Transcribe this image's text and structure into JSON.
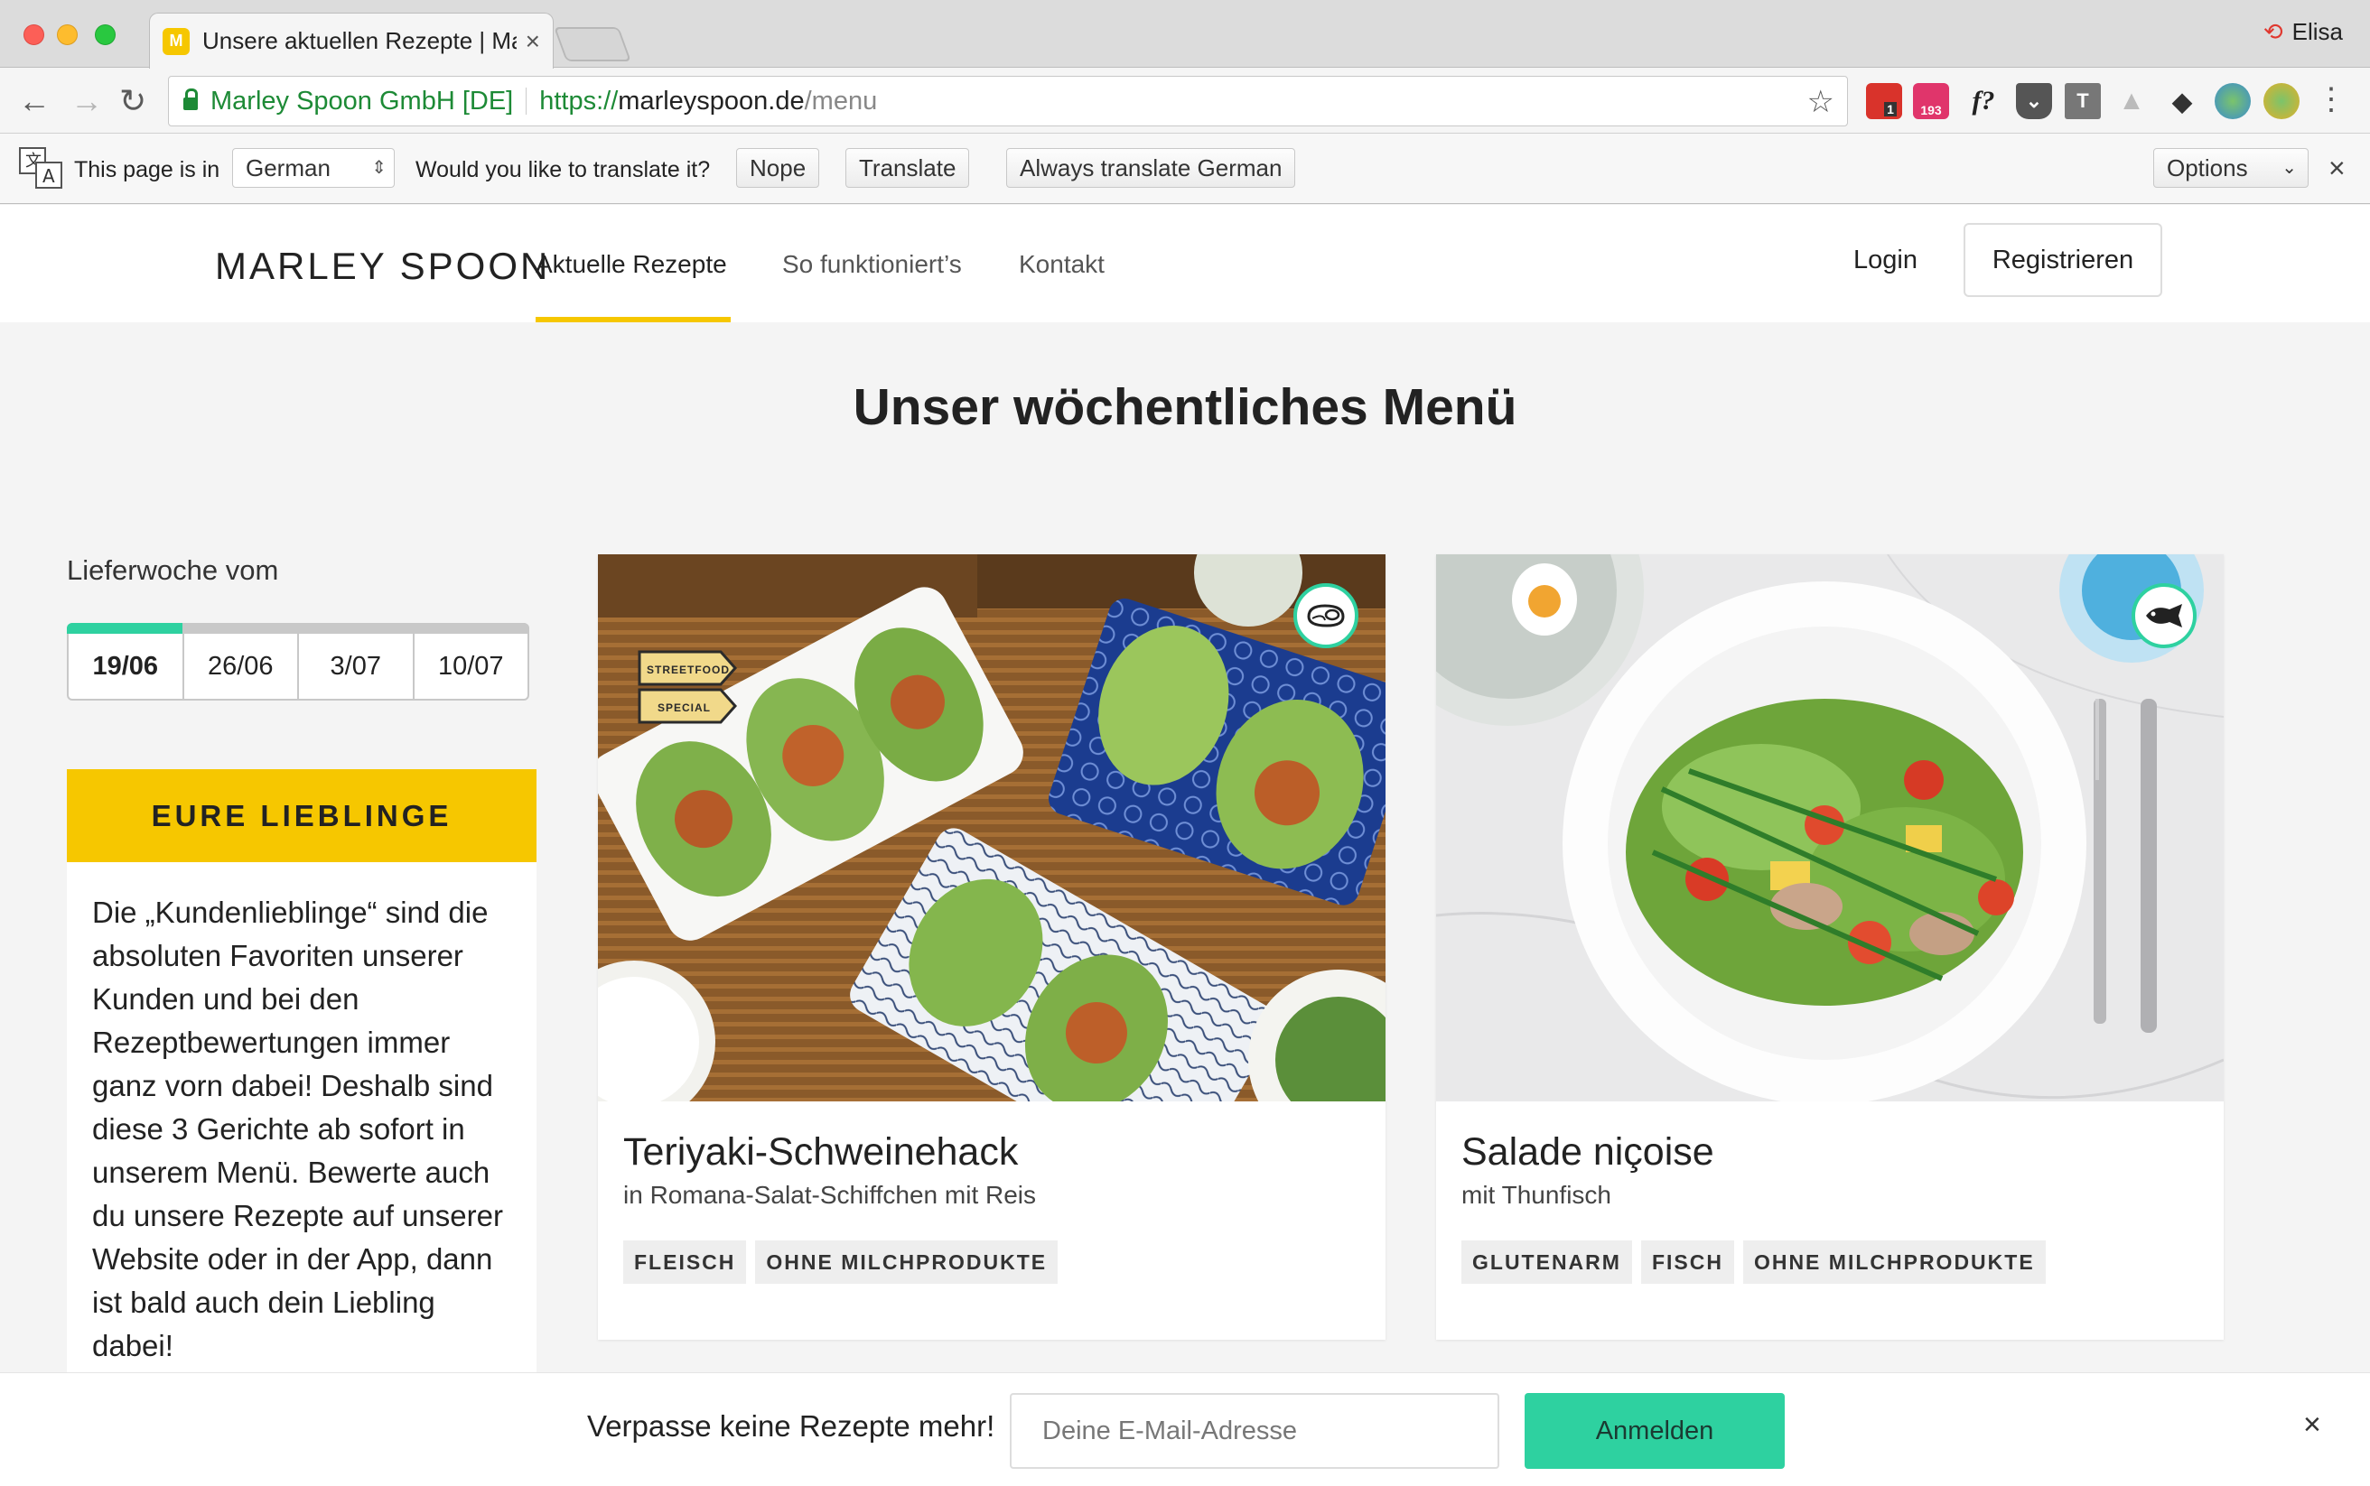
{
  "browser": {
    "tab_title": "Unsere aktuellen Rezepte | Ma",
    "tab_favicon_letter": "M",
    "profile_name": "Elisa",
    "url_origin_name": "Marley Spoon GmbH [DE]",
    "url_scheme": "https://",
    "url_host": "marleyspoon.de",
    "url_path": "/menu",
    "extensions": [
      {
        "name": "extension-1-icon",
        "label": "1",
        "color": "#d9332b"
      },
      {
        "name": "extension-193-icon",
        "label": "193",
        "color": "#e0356b"
      },
      {
        "name": "formula-icon",
        "label": "f?",
        "color": "#ffffff"
      },
      {
        "name": "pocket-icon",
        "label": "",
        "color": "#555555"
      },
      {
        "name": "t-icon",
        "label": "T",
        "color": "#777777"
      },
      {
        "name": "drive-icon",
        "label": "",
        "color": "#bbbbbb"
      },
      {
        "name": "drop-icon",
        "label": "",
        "color": "#333333"
      },
      {
        "name": "globe-icon",
        "label": "",
        "color": "#4a9bd9"
      },
      {
        "name": "globe-2-icon",
        "label": "",
        "color": "#e1b02a"
      }
    ]
  },
  "translate": {
    "page_is_in": "This page is in",
    "language": "German",
    "question": "Would you like to translate it?",
    "nope": "Nope",
    "translate": "Translate",
    "always": "Always translate German",
    "options": "Options"
  },
  "header": {
    "logo": "MARLEY SPOON",
    "nav": [
      "Aktuelle Rezepte",
      "So funktioniert’s",
      "Kontakt"
    ],
    "login": "Login",
    "register": "Registrieren"
  },
  "main": {
    "title": "Unser wöchentliches Menü",
    "week_label": "Lieferwoche vom",
    "weeks": [
      "19/06",
      "26/06",
      "3/07",
      "10/07"
    ],
    "active_week": "19/06",
    "favorites": {
      "heading": "EURE LIEBLINGE",
      "text": "Die „Kundenlieblinge“ sind die absoluten Favoriten unserer Kunden und bei den Rezeptbewertungen immer ganz vorn dabei! Deshalb sind diese 3 Gerichte ab sofort in unserem Menü. Bewerte auch du unsere Rezepte auf unserer Website oder in der App, dann ist bald auch dein Liebling dabei!"
    },
    "recipes": [
      {
        "title": "Teriyaki-Schweinehack",
        "subtitle": "in Romana-Salat-Schiffchen mit Reis",
        "tags": [
          "FLEISCH",
          "OHNE MILCHPRODUKTE"
        ],
        "badge": "meat-icon",
        "special_label_1": "STREETFOOD",
        "special_label_2": "SPECIAL"
      },
      {
        "title": "Salade niçoise",
        "subtitle": "mit Thunfisch",
        "tags": [
          "GLUTENARM",
          "FISCH",
          "OHNE MILCHPRODUKTE"
        ],
        "badge": "fish-icon"
      }
    ]
  },
  "newsletter": {
    "text": "Verpasse keine Rezepte mehr!",
    "placeholder": "Deine E-Mail-Adresse",
    "button": "Anmelden"
  },
  "colors": {
    "brand_yellow": "#f6c700",
    "accent_green": "#2ed1a0",
    "secure_green": "#1d8a36"
  }
}
